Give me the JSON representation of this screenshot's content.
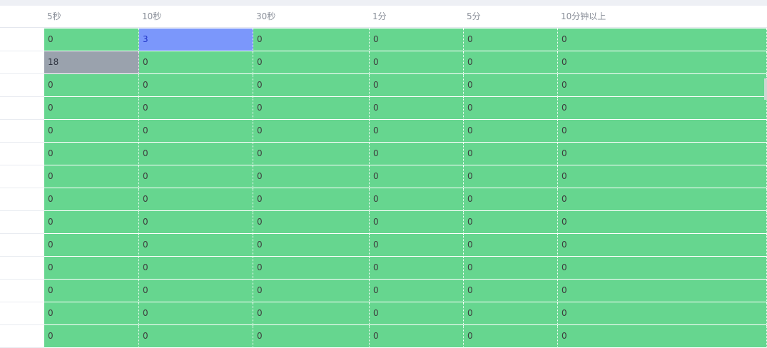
{
  "table": {
    "headers": [
      "5秒",
      "10秒",
      "30秒",
      "1分",
      "5分",
      "10分钟以上"
    ],
    "rows": [
      [
        "0",
        "3",
        "0",
        "0",
        "0",
        "0"
      ],
      [
        "18",
        "0",
        "0",
        "0",
        "0",
        "0"
      ],
      [
        "0",
        "0",
        "0",
        "0",
        "0",
        "0"
      ],
      [
        "0",
        "0",
        "0",
        "0",
        "0",
        "0"
      ],
      [
        "0",
        "0",
        "0",
        "0",
        "0",
        "0"
      ],
      [
        "0",
        "0",
        "0",
        "0",
        "0",
        "0"
      ],
      [
        "0",
        "0",
        "0",
        "0",
        "0",
        "0"
      ],
      [
        "0",
        "0",
        "0",
        "0",
        "0",
        "0"
      ],
      [
        "0",
        "0",
        "0",
        "0",
        "0",
        "0"
      ],
      [
        "0",
        "0",
        "0",
        "0",
        "0",
        "0"
      ],
      [
        "0",
        "0",
        "0",
        "0",
        "0",
        "0"
      ],
      [
        "0",
        "0",
        "0",
        "0",
        "0",
        "0"
      ],
      [
        "0",
        "0",
        "0",
        "0",
        "0",
        "0"
      ],
      [
        "0",
        "0",
        "0",
        "0",
        "0",
        "0"
      ]
    ]
  },
  "colors": {
    "cell_green": "#66d68f",
    "highlight_blue": "#7b97fb",
    "highlight_gray": "#9aa2ad"
  }
}
